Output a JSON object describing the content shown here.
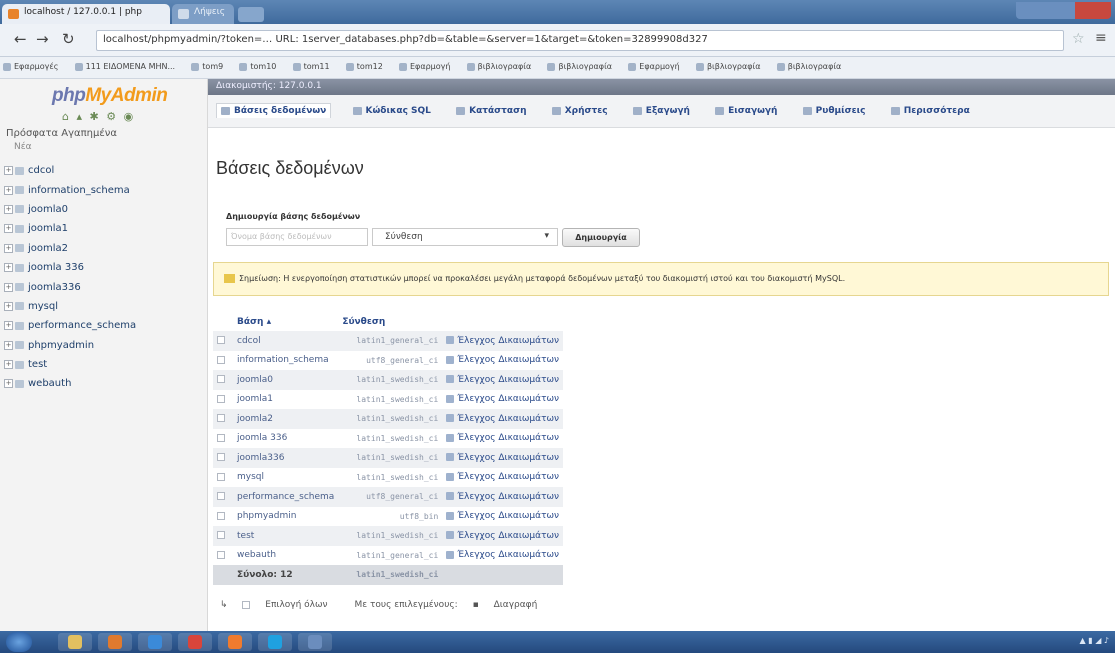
{
  "browser": {
    "tabs": [
      {
        "label": "localhost / 127.0.0.1 | php"
      },
      {
        "label": "Λήψεις"
      }
    ],
    "url": "localhost/phpmyadmin/?token=… URL: 1server_databases.php?db=&table=&server=1&target=&token=32899908d327",
    "bookmarks": [
      "Εφαρμογές",
      "111 ΕΙΔΟΜΕΝΑ ΜΗΝ...",
      "tom9",
      "tom10",
      "tom11",
      "tom12",
      "Εφαρμογή",
      "βιβλιογραφία",
      "βιβλιογραφία",
      "Εφαρμογή",
      "βιβλιογραφία",
      "βιβλιογραφία"
    ]
  },
  "pma": {
    "logo_php": "php",
    "logo_myadmin": "MyAdmin",
    "recent": "Πρόσφατα   Αγαπημένα",
    "new_db": "Νέα",
    "databases": [
      "cdcol",
      "information_schema",
      "joomla0",
      "joomla1",
      "joomla2",
      "joomla 336",
      "joomla336",
      "mysql",
      "performance_schema",
      "phpmyadmin",
      "test",
      "webauth"
    ],
    "server_bar": "Διακομιστής: 127.0.0.1",
    "tabs": [
      {
        "label": "Βάσεις δεδομένων"
      },
      {
        "label": "Κώδικας SQL"
      },
      {
        "label": "Κατάσταση"
      },
      {
        "label": "Χρήστες"
      },
      {
        "label": "Εξαγωγή"
      },
      {
        "label": "Εισαγωγή"
      },
      {
        "label": "Ρυθμίσεις"
      },
      {
        "label": "Περισσότερα"
      }
    ],
    "title": "Βάσεις δεδομένων",
    "create_label": "Δημιουργία βάσης δεδομένων",
    "create_placeholder": "Όνομα βάσης δεδομένων",
    "collation_value": "Σύνθεση",
    "create_button": "Δημιουργία",
    "notice": "Σημείωση: Η ενεργοποίηση στατιστικών μπορεί να προκαλέσει μεγάλη μεταφορά δεδομένων μεταξύ του διακομιστή ιστού και του διακομιστή MySQL.",
    "table": {
      "col_db": "Βάση",
      "col_coll": "Σύνθεση",
      "rows": [
        {
          "name": "cdcol",
          "coll": "latin1_general_ci",
          "priv": "Έλεγχος Δικαιωμάτων"
        },
        {
          "name": "information_schema",
          "coll": "utf8_general_ci",
          "priv": "Έλεγχος Δικαιωμάτων"
        },
        {
          "name": "joomla0",
          "coll": "latin1_swedish_ci",
          "priv": "Έλεγχος Δικαιωμάτων"
        },
        {
          "name": "joomla1",
          "coll": "latin1_swedish_ci",
          "priv": "Έλεγχος Δικαιωμάτων"
        },
        {
          "name": "joomla2",
          "coll": "latin1_swedish_ci",
          "priv": "Έλεγχος Δικαιωμάτων"
        },
        {
          "name": "joomla 336",
          "coll": "latin1_swedish_ci",
          "priv": "Έλεγχος Δικαιωμάτων"
        },
        {
          "name": "joomla336",
          "coll": "latin1_swedish_ci",
          "priv": "Έλεγχος Δικαιωμάτων"
        },
        {
          "name": "mysql",
          "coll": "latin1_swedish_ci",
          "priv": "Έλεγχος Δικαιωμάτων"
        },
        {
          "name": "performance_schema",
          "coll": "utf8_general_ci",
          "priv": "Έλεγχος Δικαιωμάτων"
        },
        {
          "name": "phpmyadmin",
          "coll": "utf8_bin",
          "priv": "Έλεγχος Δικαιωμάτων"
        },
        {
          "name": "test",
          "coll": "latin1_swedish_ci",
          "priv": "Έλεγχος Δικαιωμάτων"
        },
        {
          "name": "webauth",
          "coll": "latin1_general_ci",
          "priv": "Έλεγχος Δικαιωμάτων"
        }
      ],
      "total_label": "Σύνολο: 12",
      "total_coll": "latin1_swedish_ci"
    },
    "bottom": {
      "check_all": "Επιλογή όλων",
      "with_selected": "Με τους επιλεγμένους:",
      "drop": "Διαγραφή"
    }
  }
}
